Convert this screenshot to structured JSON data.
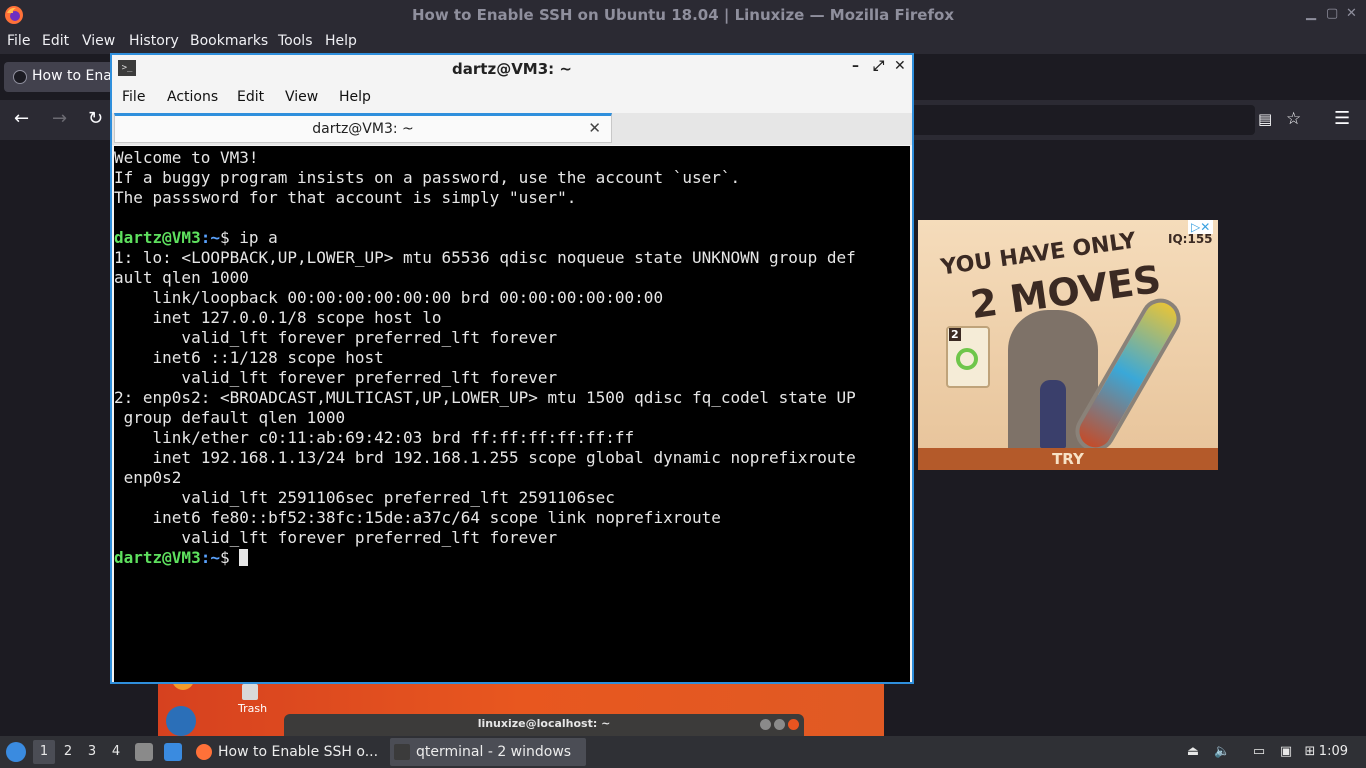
{
  "firefox": {
    "window_title": "How to Enable SSH on Ubuntu 18.04 | Linuxize — Mozilla Firefox",
    "menu": [
      "File",
      "Edit",
      "View",
      "History",
      "Bookmarks",
      "Tools",
      "Help"
    ],
    "tab_title": "How to Enable SSH on Ubuntu 18.04 | Linuxize"
  },
  "ad": {
    "headline1": "YOU HAVE ONLY",
    "headline2": "2 MOVES",
    "corner": "IQ:155",
    "card_number": "2",
    "cta": "TRY"
  },
  "desktop": {
    "trash_label": "Trash",
    "background_window_title": "linuxize@localhost: ~"
  },
  "qterminal": {
    "window_title": "dartz@VM3: ~",
    "menu": [
      "File",
      "Actions",
      "Edit",
      "View",
      "Help"
    ],
    "tab_label": "dartz@VM3: ~",
    "prompt_user": "dartz@VM3",
    "prompt_path": ":~",
    "prompt_symbol": "$ ",
    "welcome_lines": [
      "Welcome to VM3!",
      "If a buggy program insists on a password, use the account `user`.",
      "The passsword for that account is simply \"user\"."
    ],
    "command": "ip a",
    "output_lines": [
      "1: lo: <LOOPBACK,UP,LOWER_UP> mtu 65536 qdisc noqueue state UNKNOWN group def",
      "ault qlen 1000",
      "    link/loopback 00:00:00:00:00:00 brd 00:00:00:00:00:00",
      "    inet 127.0.0.1/8 scope host lo",
      "       valid_lft forever preferred_lft forever",
      "    inet6 ::1/128 scope host",
      "       valid_lft forever preferred_lft forever",
      "2: enp0s2: <BROADCAST,MULTICAST,UP,LOWER_UP> mtu 1500 qdisc fq_codel state UP",
      " group default qlen 1000",
      "    link/ether c0:11:ab:69:42:03 brd ff:ff:ff:ff:ff:ff",
      "    inet 192.168.1.13/24 brd 192.168.1.255 scope global dynamic noprefixroute",
      " enp0s2",
      "       valid_lft 2591106sec preferred_lft 2591106sec",
      "    inet6 fe80::bf52:38fc:15de:a37c/64 scope link noprefixroute",
      "       valid_lft forever preferred_lft forever"
    ]
  },
  "taskbar": {
    "workspaces": [
      "1",
      "2",
      "3",
      "4"
    ],
    "active_workspace": "1",
    "tasks": [
      {
        "label": "How to Enable SSH o..."
      },
      {
        "label": "qterminal - 2 windows"
      }
    ],
    "clock": "1:09"
  },
  "colors": {
    "accent": "#2f8fdc",
    "prompt_green": "#5ee05e",
    "prompt_blue": "#5aa3ff",
    "firefox_chrome": "#2b2a33"
  },
  "icons": {
    "firefox_logo": "firefox-icon",
    "terminal": "terminal-icon",
    "trash": "trash-icon",
    "start_menu": "lxqt-start-icon"
  }
}
